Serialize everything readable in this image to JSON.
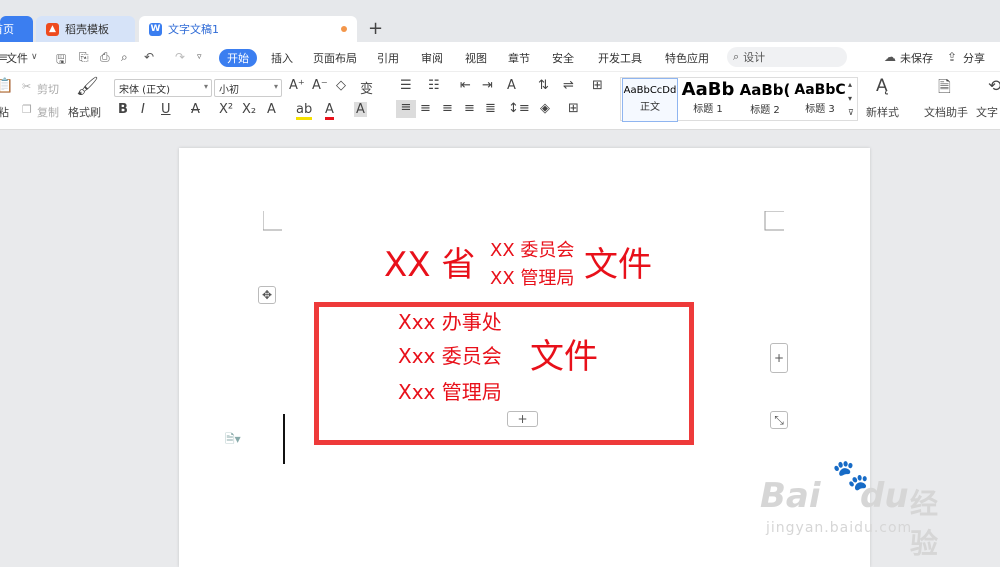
{
  "tabs": {
    "home": "首页",
    "template": "稻壳模板",
    "doc": "文字文稿1"
  },
  "menubar": {
    "file": "文件",
    "items": [
      "开始",
      "插入",
      "页面布局",
      "引用",
      "审阅",
      "视图",
      "章节",
      "安全",
      "开发工具",
      "特色应用"
    ],
    "search": "设计",
    "unsaved": "未保存",
    "share": "分享"
  },
  "ribbon": {
    "cut": "剪切",
    "copy": "复制",
    "paste_partial": "粘",
    "format_painter": "格式刷",
    "font_name": "宋体 (正文)",
    "font_size": "小初",
    "styles": [
      {
        "sample": "AaBbCcDd",
        "name": "正文"
      },
      {
        "sample": "AaBb",
        "name": "标题 1"
      },
      {
        "sample": "AaBb(",
        "name": "标题 2"
      },
      {
        "sample": "AaBbC",
        "name": "标题 3"
      }
    ],
    "new_style": "新样式",
    "doc_helper": "文档助手",
    "text_tool": "文字"
  },
  "document": {
    "header": {
      "province": "XX 省",
      "org_top": "XX 委员会",
      "org_bottom": "XX 管理局",
      "suffix": "文件"
    },
    "box": {
      "line1": "Xxx 办事处",
      "line2": "Xxx 委员会",
      "line3": "Xxx 管理局",
      "suffix": "文件"
    }
  },
  "watermark": {
    "brand": "Bai",
    "brand2": "du",
    "cn": "经验",
    "url": "jingyan.baidu.com"
  },
  "colors": {
    "accent": "#3b7ef0",
    "doc_red": "#e8101a",
    "box_red": "#ee3a3a"
  }
}
